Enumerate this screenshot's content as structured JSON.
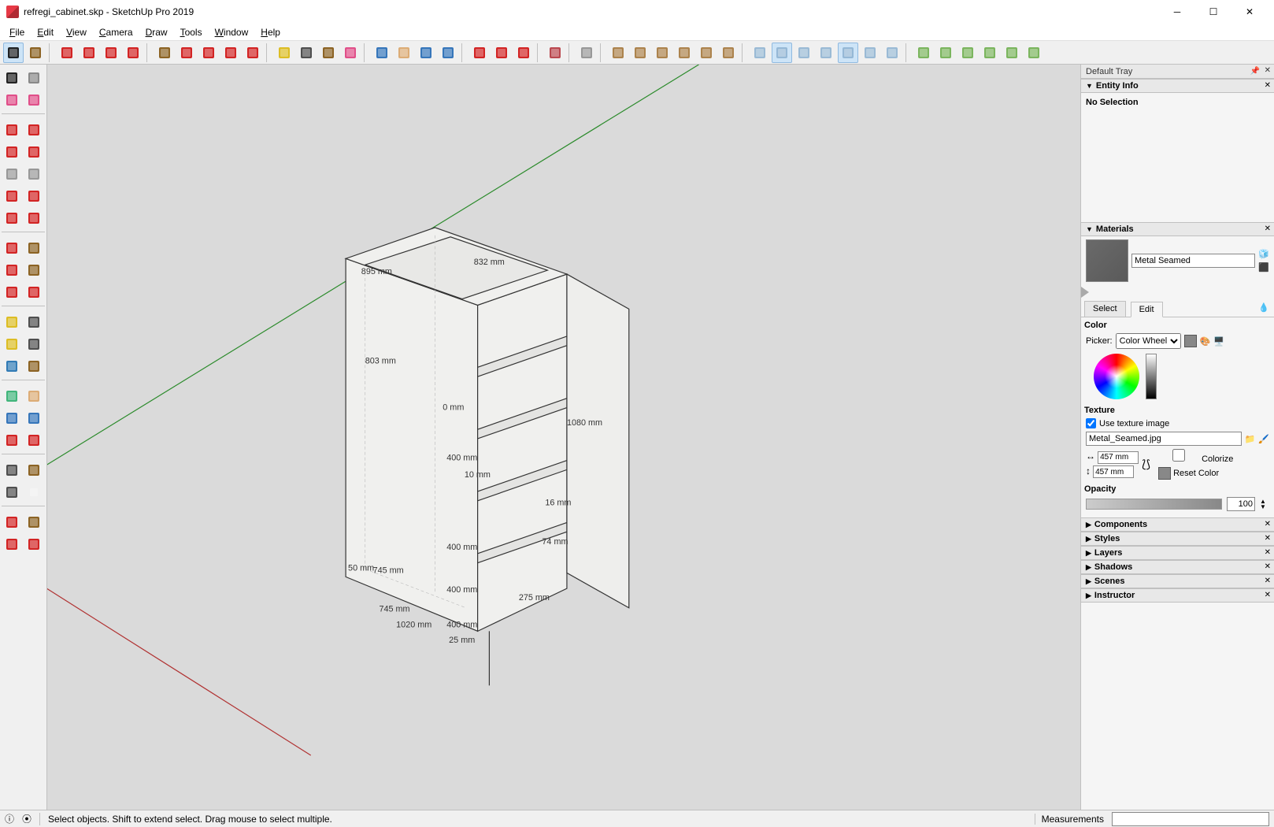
{
  "window": {
    "title": "refregi_cabinet.skp - SketchUp Pro 2019"
  },
  "menus": [
    "File",
    "Edit",
    "View",
    "Camera",
    "Draw",
    "Tools",
    "Window",
    "Help"
  ],
  "top_tools": [
    {
      "n": "select-arrow",
      "c": "#000",
      "sel": true
    },
    {
      "n": "make-component",
      "c": "#7a4a00"
    },
    {
      "sep": true
    },
    {
      "n": "line",
      "c": "#c00"
    },
    {
      "n": "rectangle",
      "c": "#c00"
    },
    {
      "n": "circle",
      "c": "#c00"
    },
    {
      "n": "arc",
      "c": "#c00"
    },
    {
      "sep": true
    },
    {
      "n": "pushpull",
      "c": "#7a4a00"
    },
    {
      "n": "offset",
      "c": "#c00"
    },
    {
      "n": "move",
      "c": "#c00"
    },
    {
      "n": "rotate",
      "c": "#c00"
    },
    {
      "n": "scale",
      "c": "#c00"
    },
    {
      "sep": true
    },
    {
      "n": "tape",
      "c": "#d8b400"
    },
    {
      "n": "text",
      "c": "#333"
    },
    {
      "n": "paint",
      "c": "#7a4a00"
    },
    {
      "n": "eraser",
      "c": "#d37"
    },
    {
      "sep": true
    },
    {
      "n": "orbit",
      "c": "#1560b0"
    },
    {
      "n": "pan",
      "c": "#d8a060"
    },
    {
      "n": "zoom",
      "c": "#1560b0"
    },
    {
      "n": "zoom-extents",
      "c": "#1560b0"
    },
    {
      "sep": true
    },
    {
      "n": "get-models",
      "c": "#c00"
    },
    {
      "n": "share",
      "c": "#c00"
    },
    {
      "n": "credits",
      "c": "#c00"
    },
    {
      "sep": true
    },
    {
      "n": "extension-warehouse",
      "c": "#b02a33"
    },
    {
      "sep": true
    },
    {
      "n": "user",
      "c": "#888"
    },
    {
      "sep": true
    },
    {
      "n": "iso",
      "c": "#a07030"
    },
    {
      "n": "top",
      "c": "#a07030"
    },
    {
      "n": "front",
      "c": "#a07030"
    },
    {
      "n": "back",
      "c": "#a07030"
    },
    {
      "n": "left",
      "c": "#a07030"
    },
    {
      "n": "right",
      "c": "#a07030"
    },
    {
      "sep": true
    },
    {
      "n": "xray",
      "c": "#8bb0d0"
    },
    {
      "n": "backedges",
      "c": "#8bb0d0",
      "sel": true
    },
    {
      "n": "wireframe",
      "c": "#8bb0d0"
    },
    {
      "n": "hidden-line",
      "c": "#8bb0d0"
    },
    {
      "n": "shaded",
      "c": "#8bb0d0",
      "sel": true
    },
    {
      "n": "shaded-tex",
      "c": "#8bb0d0"
    },
    {
      "n": "monochrome",
      "c": "#8bb0d0"
    },
    {
      "sep": true
    },
    {
      "n": "section-plane",
      "c": "#6a4"
    },
    {
      "n": "section-display",
      "c": "#6a4"
    },
    {
      "n": "section-cut",
      "c": "#6a4"
    },
    {
      "n": "section-fill",
      "c": "#6a4"
    },
    {
      "n": "prev-scene",
      "c": "#6a4"
    },
    {
      "n": "next-scene",
      "c": "#6a4"
    }
  ],
  "side_rows": [
    [
      {
        "n": "select",
        "c": "#000"
      },
      {
        "n": "lasso",
        "c": "#777"
      }
    ],
    [
      {
        "n": "eraser",
        "c": "#d37"
      },
      {
        "n": "paint",
        "c": "#d37"
      }
    ],
    "sep",
    [
      {
        "n": "line",
        "c": "#c00"
      },
      {
        "n": "freehand",
        "c": "#c00"
      }
    ],
    [
      {
        "n": "rectangle",
        "c": "#c00"
      },
      {
        "n": "rotated-rect",
        "c": "#c00"
      }
    ],
    [
      {
        "n": "circle",
        "c": "#888"
      },
      {
        "n": "polygon",
        "c": "#888"
      }
    ],
    [
      {
        "n": "arc",
        "c": "#c00"
      },
      {
        "n": "2pt-arc",
        "c": "#c00"
      }
    ],
    [
      {
        "n": "3pt-arc",
        "c": "#c00"
      },
      {
        "n": "pie",
        "c": "#c00"
      }
    ],
    "sep",
    [
      {
        "n": "move",
        "c": "#c00"
      },
      {
        "n": "pushpull",
        "c": "#7a4a00"
      }
    ],
    [
      {
        "n": "rotate",
        "c": "#c00"
      },
      {
        "n": "followme",
        "c": "#7a4a00"
      }
    ],
    [
      {
        "n": "scale",
        "c": "#c00"
      },
      {
        "n": "offset",
        "c": "#c00"
      }
    ],
    "sep",
    [
      {
        "n": "tape",
        "c": "#d8b400"
      },
      {
        "n": "dimension",
        "c": "#333"
      }
    ],
    [
      {
        "n": "protractor",
        "c": "#d8b400"
      },
      {
        "n": "text-label",
        "c": "#333"
      }
    ],
    [
      {
        "n": "axes",
        "c": "#16a"
      },
      {
        "n": "3dtext",
        "c": "#7a4a00"
      }
    ],
    "sep",
    [
      {
        "n": "section",
        "c": "#2a6"
      },
      {
        "n": "orbit",
        "c": "#d8a060"
      }
    ],
    [
      {
        "n": "pan",
        "c": "#1560b0"
      },
      {
        "n": "zoom",
        "c": "#1560b0"
      }
    ],
    [
      {
        "n": "zoom-window",
        "c": "#c00"
      },
      {
        "n": "zoom-extents",
        "c": "#c00"
      }
    ],
    "sep",
    [
      {
        "n": "position-camera",
        "c": "#333"
      },
      {
        "n": "look-around",
        "c": "#7a4a00"
      }
    ],
    [
      {
        "n": "walk",
        "c": "#333"
      },
      {
        "n": "",
        "c": "transparent"
      }
    ],
    "sep",
    [
      {
        "n": "sandbox1",
        "c": "#c00"
      },
      {
        "n": "sandbox2",
        "c": "#7a4a00"
      }
    ],
    [
      {
        "n": "sandbox3",
        "c": "#c00"
      },
      {
        "n": "sandbox4",
        "c": "#c00"
      }
    ]
  ],
  "tray": {
    "title": "Default Tray",
    "entity_info": {
      "header": "Entity Info",
      "no_selection": "No Selection"
    },
    "materials": {
      "header": "Materials",
      "name": "Metal Seamed",
      "tabs": {
        "select": "Select",
        "edit": "Edit"
      },
      "color_label": "Color",
      "picker_label": "Picker:",
      "picker_value": "Color Wheel",
      "texture_label": "Texture",
      "use_texture": "Use texture image",
      "texture_file": "Metal_Seamed.jpg",
      "width": "457 mm",
      "height": "457 mm",
      "colorize": "Colorize",
      "reset_color": "Reset Color",
      "opacity_label": "Opacity",
      "opacity_value": "100"
    },
    "collapsed": [
      "Components",
      "Styles",
      "Layers",
      "Shadows",
      "Scenes",
      "Instructor"
    ]
  },
  "status": {
    "hint": "Select objects. Shift to extend select. Drag mouse to select multiple.",
    "measurements_label": "Measurements"
  },
  "model_dims": {
    "d895": "895 mm",
    "d832": "832 mm",
    "d803": "803 mm",
    "d0": "0 mm",
    "d400a": "400 mm",
    "d1080": "1080 mm",
    "d400b": "400 mm",
    "d400c": "400 mm",
    "d400d": "400 mm",
    "d50": "50 mm",
    "d745a": "745 mm",
    "d745b": "745 mm",
    "d1020": "1020 mm",
    "d275": "275 mm",
    "d25": "25 mm",
    "d10": "10 mm",
    "d74": "74 mm",
    "d16": "16 mm"
  }
}
